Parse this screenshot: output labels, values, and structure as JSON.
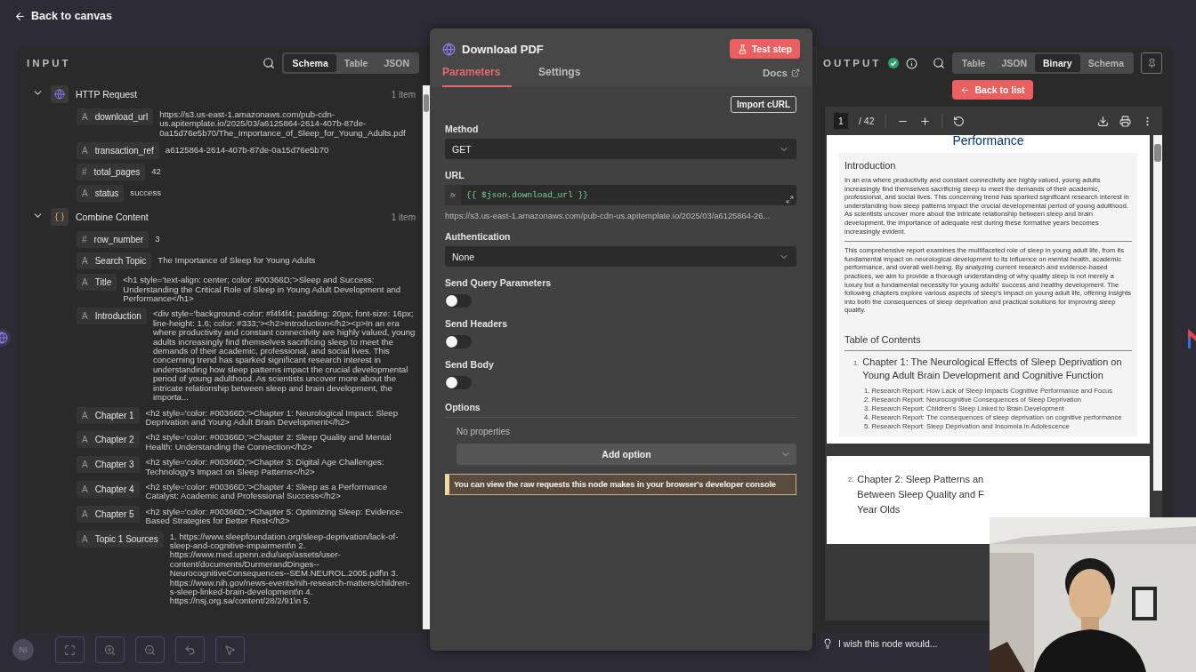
{
  "top_bar": {
    "back_link": "Back to canvas"
  },
  "input_panel": {
    "title": "INPUT",
    "view_tabs": [
      {
        "label": "Schema",
        "selected": true
      },
      {
        "label": "Table",
        "selected": false
      },
      {
        "label": "JSON",
        "selected": false
      }
    ],
    "nodes": [
      {
        "kind": "http",
        "name": "HTTP Request",
        "count": "1 item",
        "expanded": true,
        "fields": [
          {
            "type": "A",
            "key": "download_url",
            "value": "https://s3.us-east-1.amazonaws.com/pub-cdn-us.apitemplate.io/2025/03/a6125864-2614-407b-87de-0a15d76e5b70/The_Importance_of_Sleep_for_Young_Adults.pdf"
          },
          {
            "type": "A",
            "key": "transaction_ref",
            "value": "a6125864-2614-407b-87de-0a15d76e5b70"
          },
          {
            "type": "#",
            "key": "total_pages",
            "value": "42"
          },
          {
            "type": "A",
            "key": "status",
            "value": "success"
          }
        ]
      },
      {
        "kind": "code",
        "name": "Combine Content",
        "count": "1 item",
        "expanded": true,
        "fields": [
          {
            "type": "#",
            "key": "row_number",
            "value": "3"
          },
          {
            "type": "A",
            "key": "Search Topic",
            "value": "The Importance of Sleep for Young Adults"
          },
          {
            "type": "A",
            "key": "Title",
            "value": "<h1 style='text-align: center; color: #00366D;'>Sleep and Success: Understanding the Critical Role of Sleep in Young Adult Development and Performance</h1>"
          },
          {
            "type": "A",
            "key": "Introduction",
            "value": "<div style='background-color: #f4f4f4; padding: 20px; font-size: 16px; line-height: 1.6; color: #333;'><h2>Introduction</h2><p>In an era where productivity and constant connectivity are highly valued, young adults increasingly find themselves sacrificing sleep to meet the demands of their academic, professional, and social lives. This concerning trend has sparked significant research interest in understanding how sleep patterns impact the crucial developmental period of young adulthood. As scientists uncover more about the intricate relationship between sleep and brain development, the importa..."
          },
          {
            "type": "A",
            "key": "Chapter 1",
            "value": "<h2 style='color: #00366D;'>Chapter 1: Neurological Impact: Sleep Deprivation and Young Adult Brain Development</h2>"
          },
          {
            "type": "A",
            "key": "Chapter 2",
            "value": "<h2 style='color: #00366D;'>Chapter 2: Sleep Quality and Mental Health: Understanding the Connection</h2>"
          },
          {
            "type": "A",
            "key": "Chapter 3",
            "value": "<h2 style='color: #00366D;'>Chapter 3: Digital Age Challenges: Technology's Impact on Sleep Patterns</h2>"
          },
          {
            "type": "A",
            "key": "Chapter 4",
            "value": "<h2 style='color: #00366D;'>Chapter 4: Sleep as a Performance Catalyst: Academic and Professional Success</h2>"
          },
          {
            "type": "A",
            "key": "Chapter 5",
            "value": "<h2 style='color: #00366D;'>Chapter 5: Optimizing Sleep: Evidence-Based Strategies for Better Rest</h2>"
          },
          {
            "type": "A",
            "key": "Topic 1 Sources",
            "value": "1. https://www.sleepfoundation.org/sleep-deprivation/lack-of-sleep-and-cognitive-impairment\\n 2. https://www.med.upenn.edu/uep/assets/user-content/documents/DurmerandDinges--NeurocognitiveConsequences--SEM.NEUROL.2005.pdf\\n 3. https://www.nih.gov/news-events/nih-research-matters/children-s-sleep-linked-brain-development\\n 4. https://nsj.org.sa/content/28/2/91\\n 5."
          }
        ]
      }
    ]
  },
  "node_panel": {
    "title": "Download PDF",
    "test_button": "Test step",
    "tabs": [
      {
        "label": "Parameters",
        "selected": true
      },
      {
        "label": "Settings",
        "selected": false
      }
    ],
    "docs_link": "Docs",
    "import_button": "Import cURL",
    "params": [
      {
        "kind": "select",
        "label": "Method",
        "value": "GET"
      },
      {
        "kind": "expression",
        "label": "URL",
        "fx": "fx",
        "value": "{{ $json.download_url }}",
        "preview": "https://s3.us-east-1.amazonaws.com/pub-cdn-us.apitemplate.io/2025/03/a6125864-26..."
      },
      {
        "kind": "select",
        "label": "Authentication",
        "value": "None"
      },
      {
        "kind": "toggle",
        "label": "Send Query Parameters",
        "on": false
      },
      {
        "kind": "toggle",
        "label": "Send Headers",
        "on": false
      },
      {
        "kind": "toggle",
        "label": "Send Body",
        "on": false
      }
    ],
    "options": {
      "title": "Options",
      "empty": "No properties",
      "add_button": "Add option"
    },
    "notice": "You can view the raw requests this node makes in your browser's developer console"
  },
  "output_panel": {
    "title": "OUTPUT",
    "view_tabs": [
      {
        "label": "Table",
        "selected": false
      },
      {
        "label": "JSON",
        "selected": false
      },
      {
        "label": "Binary",
        "selected": true
      },
      {
        "label": "Schema",
        "selected": false
      }
    ],
    "back_button": "Back to list",
    "viewer": {
      "page": "1",
      "page_total": "/ 42",
      "page1": {
        "title_tail": "Performance",
        "intro_heading": "Introduction",
        "paragraphs": [
          "In an era where productivity and constant connectivity are highly valued, young adults increasingly find themselves sacrificing sleep to meet the demands of their academic, professional, and social lives. This concerning trend has sparked significant research interest in understanding how sleep patterns impact the crucial developmental period of young adulthood. As scientists uncover more about the intricate relationship between sleep and brain development, the importance of adequate rest during these formative years becomes increasingly evident.",
          "This comprehensive report examines the multifaceted role of sleep in young adult life, from its fundamental impact on neurological development to its influence on mental health, academic performance, and overall well-being. By analyzing current research and evidence-based practices, we aim to provide a thorough understanding of why quality sleep is not merely a luxury but a fundamental necessity for young adults' success and healthy development. The following chapters explore various aspects of sleep's impact on young adult life, offering insights into both the consequences of sleep deprivation and practical solutions for improving sleep quality."
        ],
        "toc_heading": "Table of Contents",
        "chapter": {
          "number": "1.",
          "title": "Chapter 1: The Neurological Effects of Sleep Deprivation on Young Adult Brain Development and Cognitive Function",
          "reports": [
            "1. Research Report: How Lack of Sleep Impacts Cognitive Performance and Focus",
            "2. Research Report: Neurocognitive Consequences of Sleep Deprivation",
            "3. Research Report: Children's Sleep Linked to Brain Development",
            "4. Research Report: The consequences of sleep deprivation on cognitive performance",
            "5. Research Report: Sleep Deprivation and Insomnia in Adolescence"
          ]
        }
      },
      "page2": {
        "number": "2.",
        "title_lines": [
          "Chapter 2: Sleep Patterns an",
          "Between Sleep Quality and F",
          "Year Olds"
        ]
      }
    }
  },
  "canvas": {
    "avatar": "NI",
    "feedback": "I wish this node would..."
  }
}
